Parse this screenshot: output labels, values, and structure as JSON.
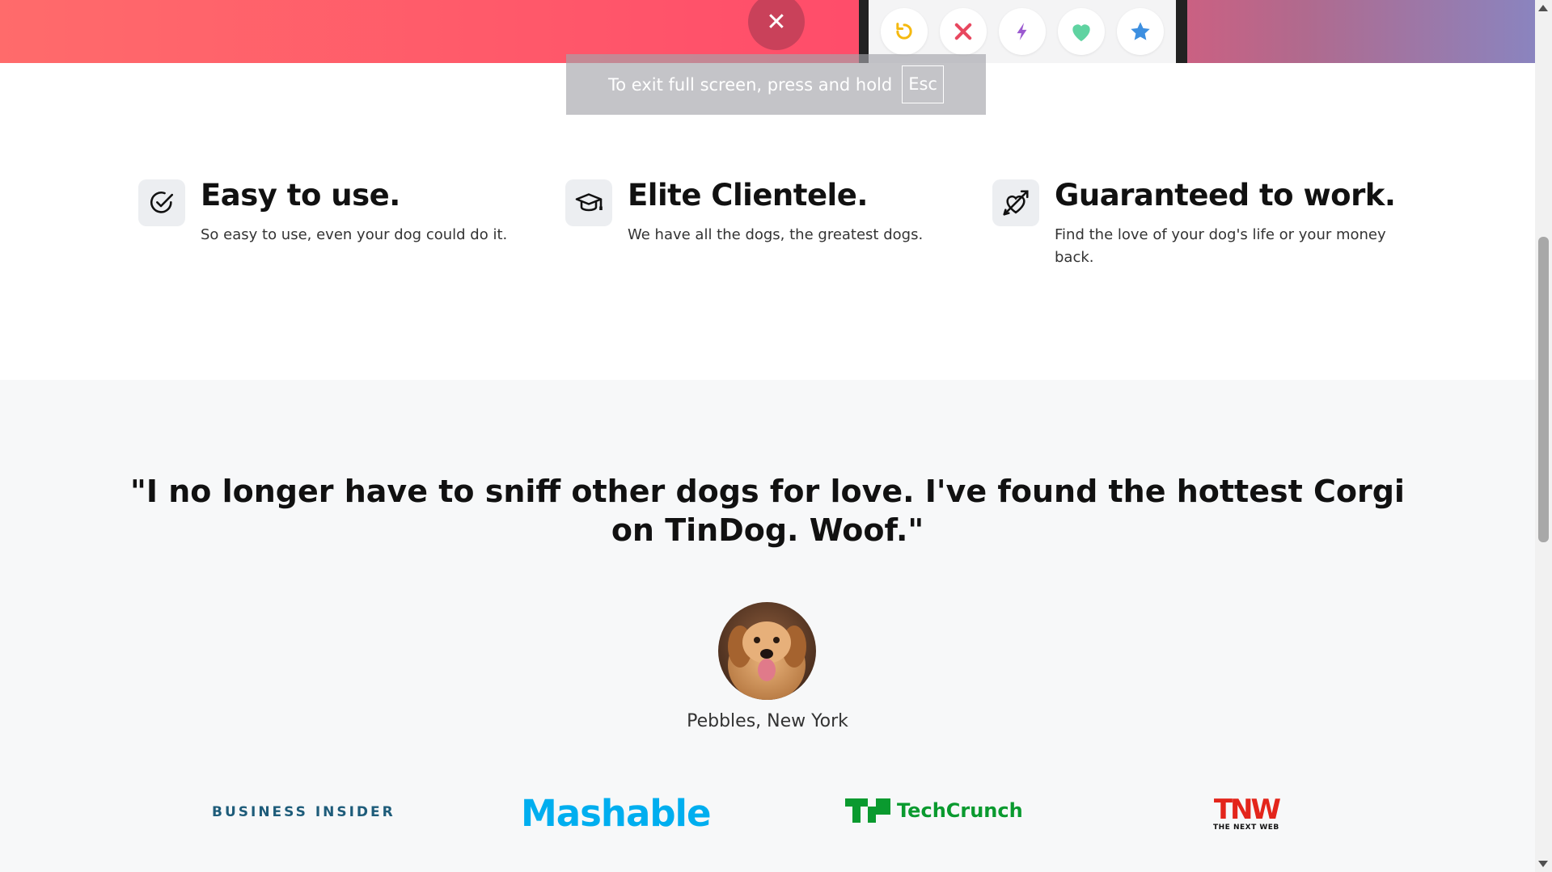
{
  "fullscreen_toast": {
    "text": "To exit full screen, press and hold",
    "key": "Esc"
  },
  "top_bar": {
    "close_symbol": "✕",
    "buttons": [
      {
        "icon": "undo-icon",
        "color": "#f5b90f"
      },
      {
        "icon": "close-icon",
        "color": "#e8475f"
      },
      {
        "icon": "lightning-icon",
        "color": "#9b59d0"
      },
      {
        "icon": "heart-icon",
        "color": "#5fd3a1"
      },
      {
        "icon": "star-icon",
        "color": "#3d8fe0"
      }
    ]
  },
  "features": [
    {
      "title": "Easy to use.",
      "desc": "So easy to use, even your dog could do it.",
      "icon": "check-circle-icon"
    },
    {
      "title": "Elite Clientele.",
      "desc": "We have all the dogs, the greatest dogs.",
      "icon": "graduation-cap-icon"
    },
    {
      "title": "Guaranteed to work.",
      "desc": "Find the love of your dog's life or your money back.",
      "icon": "heart-arrow-icon"
    }
  ],
  "testimonial": {
    "quote": "\"I no longer have to sniff other dogs for love. I've found the hottest Corgi on TinDog. Woof.\"",
    "author": "Pebbles, New York"
  },
  "press": {
    "business_insider": "BUSINESS INSIDER",
    "mashable": "Mashable",
    "techcrunch": "TechCrunch",
    "tnw_mark": "TNW",
    "tnw_sub": "THE NEXT WEB"
  },
  "colors": {
    "brand": "#ff4d6a",
    "section_bg": "#f7f8f9"
  }
}
